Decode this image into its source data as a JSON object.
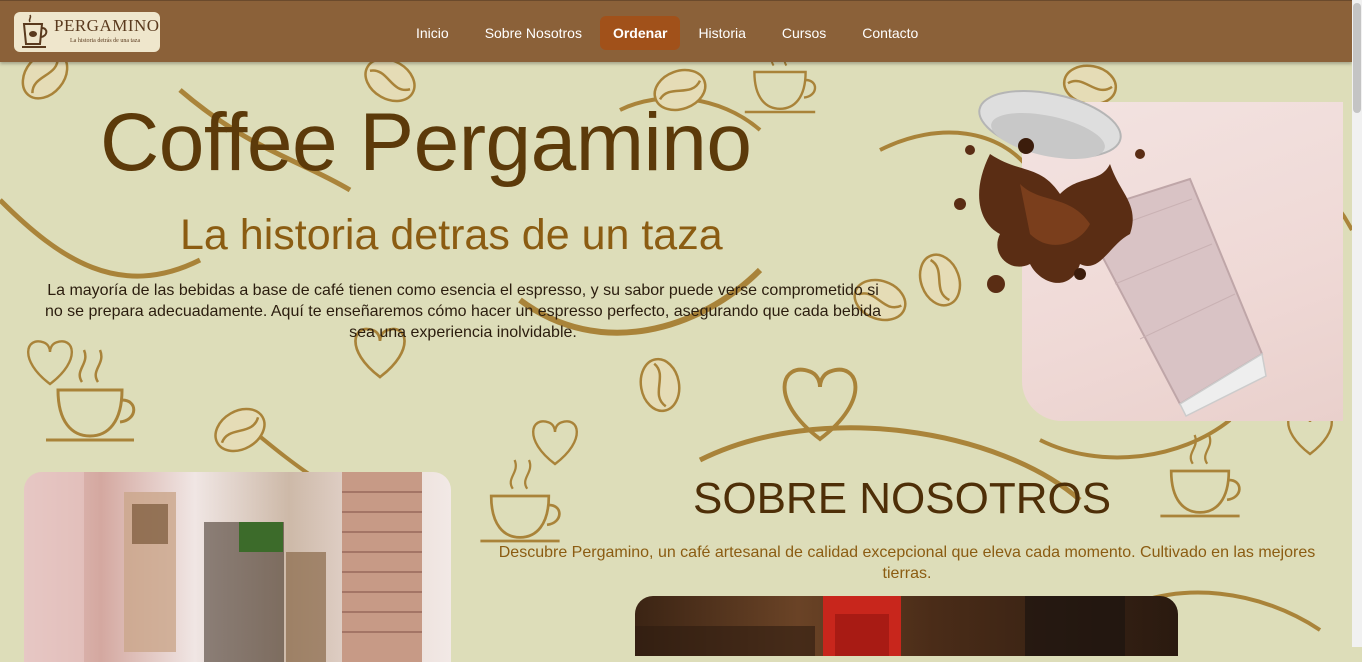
{
  "brand": {
    "name": "PERGAMINO",
    "tagline": "La historia detrás de una taza"
  },
  "nav": {
    "items": [
      {
        "label": "Inicio"
      },
      {
        "label": "Sobre Nosotros"
      },
      {
        "label": "Ordenar",
        "active": true
      },
      {
        "label": "Historia"
      },
      {
        "label": "Cursos"
      },
      {
        "label": "Contacto"
      }
    ]
  },
  "hero": {
    "title": "Coffee Pergamino",
    "subtitle": "La historia detras de un taza",
    "description": "La mayoría de las bebidas a base de café tienen como esencia el espresso, y su sabor puede verse comprometido si no se prepara adecuadamente. Aquí te enseñaremos cómo hacer un espresso perfecto, asegurando que cada bebida sea una experiencia inolvidable."
  },
  "about": {
    "title": "SOBRE NOSOTROS",
    "description": "Descubre Pergamino, un café artesanal de calidad excepcional que eleva cada momento. Cultivado en las mejores tierras."
  },
  "colors": {
    "navbar": "#8b6139",
    "active_nav": "#a1511a",
    "page_background": "#ddddb9",
    "title": "#5c3a0a",
    "subtitle": "#8b5c12"
  },
  "icons": {
    "logo": "coffee-cup-logo-icon",
    "pattern": "coffee-bean-and-cup-pattern"
  }
}
